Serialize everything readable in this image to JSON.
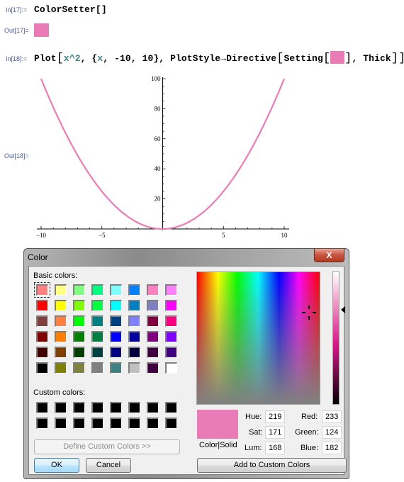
{
  "notebook": {
    "cells": [
      {
        "label": "In[17]:=",
        "code": "ColorSetter[]"
      },
      {
        "label": "Out[17]="
      },
      {
        "label": "In[18]:=",
        "code_parts": {
          "plot": "Plot",
          "open1": "[",
          "x_sq": "x^2",
          "sep1": ", {",
          "x": "x",
          "range": ", -10, 10}, PlotStyle→Directive",
          "open2": "[",
          "setting": "Setting",
          "open3": "[",
          "close3": "]",
          "thick": ", Thick",
          "close2": "]]"
        }
      },
      {
        "label": "Out[18]="
      }
    ],
    "selected_color": "#e97cb6"
  },
  "chart_data": {
    "type": "line",
    "title": "",
    "function": "x^2",
    "xlabel": "",
    "ylabel": "",
    "xlim": [
      -10,
      10
    ],
    "ylim": [
      0,
      100
    ],
    "x_ticks": [
      -10,
      -5,
      5,
      10
    ],
    "y_ticks": [
      20,
      40,
      60,
      80,
      100
    ],
    "series": [
      {
        "name": "x^2",
        "color": "#e97cb6",
        "x": [
          -10,
          -9,
          -8,
          -7,
          -6,
          -5,
          -4,
          -3,
          -2,
          -1,
          0,
          1,
          2,
          3,
          4,
          5,
          6,
          7,
          8,
          9,
          10
        ],
        "y": [
          100,
          81,
          64,
          49,
          36,
          25,
          16,
          9,
          4,
          1,
          0,
          1,
          4,
          9,
          16,
          25,
          36,
          49,
          64,
          81,
          100
        ]
      }
    ],
    "grid": false,
    "legend": "none"
  },
  "dialog": {
    "title": "Color",
    "close_label": "X",
    "basic_colors_label": "Basic colors:",
    "basic_colors": [
      [
        "#ff8080",
        "#ffff80",
        "#80ff80",
        "#00ff80",
        "#80ffff",
        "#0080ff",
        "#ff80c0",
        "#ff80ff"
      ],
      [
        "#ff0000",
        "#ffff00",
        "#80ff00",
        "#00ff40",
        "#00ffff",
        "#0080c0",
        "#8080c0",
        "#ff00ff"
      ],
      [
        "#804040",
        "#ff8040",
        "#00ff00",
        "#008080",
        "#004080",
        "#8080ff",
        "#800040",
        "#ff0080"
      ],
      [
        "#800000",
        "#ff8000",
        "#008000",
        "#008040",
        "#0000ff",
        "#0000a0",
        "#800080",
        "#8000ff"
      ],
      [
        "#400000",
        "#804000",
        "#004000",
        "#004040",
        "#000080",
        "#000040",
        "#400040",
        "#400080"
      ],
      [
        "#000000",
        "#808000",
        "#808040",
        "#808080",
        "#408080",
        "#c0c0c0",
        "#400040",
        "#ffffff"
      ]
    ],
    "custom_colors_label": "Custom colors:",
    "custom_colors": [
      [
        "#000000",
        "#000000",
        "#000000",
        "#000000",
        "#000000",
        "#000000",
        "#000000",
        "#000000"
      ],
      [
        "#000000",
        "#000000",
        "#000000",
        "#000000",
        "#000000",
        "#000000",
        "#000000",
        "#000000"
      ]
    ],
    "define_custom_label": "Define Custom Colors >>",
    "ok_label": "OK",
    "cancel_label": "Cancel",
    "preview_label": "Color|Solid",
    "preview_color": "#e97cb6",
    "hue_label": "Hue:",
    "hue": "219",
    "sat_label": "Sat:",
    "sat": "171",
    "lum_label": "Lum:",
    "lum": "168",
    "red_label": "Red:",
    "red": "233",
    "green_label": "Green:",
    "green": "124",
    "blue_label": "Blue:",
    "blue": "182",
    "add_custom_label": "Add to Custom Colors"
  }
}
